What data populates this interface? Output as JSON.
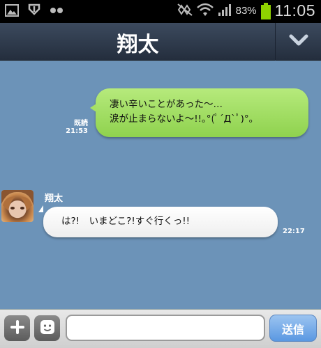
{
  "status_bar": {
    "battery_percent": "83%",
    "time": "11:05",
    "icons": [
      "gallery-icon",
      "download-icon",
      "dots-icon",
      "mute-icon",
      "wifi-icon",
      "signal-icon",
      "battery-icon"
    ]
  },
  "header": {
    "title": "翔太",
    "dropdown_icon": "chevron-down-icon"
  },
  "messages": [
    {
      "direction": "outgoing",
      "text": "凄い辛いことがあった～…\n涙が止まらないよ～!!｡°(ﾟ´Д`ﾟ)°｡",
      "read_label": "既読",
      "time": "21:53"
    },
    {
      "direction": "incoming",
      "sender": "翔太",
      "text": "は?!　いまどこ?!すぐ行くっ!!",
      "time": "22:17"
    }
  ],
  "input_bar": {
    "plus_icon": "plus-icon",
    "emoji_icon": "emoji-icon",
    "input_value": "",
    "send_label": "送信"
  },
  "colors": {
    "chat_background": "#6c93b8",
    "outgoing_bubble": "#a6e066",
    "incoming_bubble": "#ffffff",
    "send_button": "#5a98e2",
    "battery": "#8fd100"
  }
}
